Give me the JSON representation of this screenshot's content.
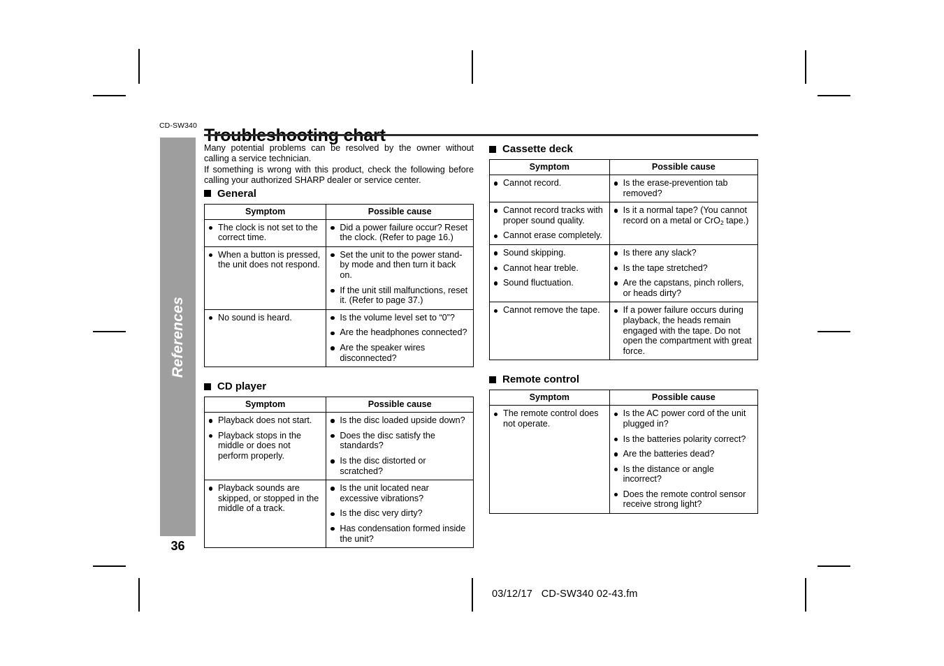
{
  "page": {
    "model_code": "CD-SW340",
    "title": "Troubleshooting chart",
    "side_tab_label": "References",
    "page_number": "36"
  },
  "intro": {
    "line1": "Many potential problems can be resolved by the owner without",
    "line2": "calling a service technician.",
    "line3": "If something is wrong with this product, check the following before",
    "line4": "calling your authorized SHARP dealer or service center."
  },
  "table_headers": {
    "symptom": "Symptom",
    "possible_cause": "Possible cause"
  },
  "sections": [
    {
      "id": "general",
      "heading": "General",
      "rows": [
        {
          "symptoms": [
            "The clock is not set to the correct time."
          ],
          "causes": [
            "Did a power failure occur? Reset the clock. (Refer to page 16.)"
          ]
        },
        {
          "symptoms": [
            "When a button is pressed, the unit does not respond."
          ],
          "causes": [
            "Set the unit to the power stand-by mode and then turn it back on.",
            "If the unit still malfunctions, reset it. (Refer to page 37.)"
          ]
        },
        {
          "symptoms": [
            "No sound is heard."
          ],
          "causes": [
            "Is the volume level set to “0”?",
            "Are the headphones connected?",
            "Are the speaker wires disconnected?"
          ]
        }
      ]
    },
    {
      "id": "cd-player",
      "heading": "CD player",
      "rows": [
        {
          "symptoms": [
            "Playback does not start.",
            "Playback stops in the middle or does not perform properly."
          ],
          "causes": [
            "Is the disc loaded upside down?",
            "Does the disc satisfy the standards?",
            "Is the disc distorted or scratched?"
          ]
        },
        {
          "symptoms": [
            "Playback sounds are skipped, or stopped in the middle of a track."
          ],
          "causes": [
            "Is the unit located near excessive vibrations?",
            "Is the disc very dirty?",
            "Has condensation formed inside the unit?"
          ]
        }
      ]
    },
    {
      "id": "cassette-deck",
      "heading": "Cassette deck",
      "rows": [
        {
          "symptoms": [
            "Cannot record."
          ],
          "causes": [
            "Is the erase-prevention tab removed?"
          ]
        },
        {
          "symptoms": [
            "Cannot record tracks with proper sound quality.",
            "Cannot erase completely."
          ],
          "causes_html": [
            "Is it a normal tape? (You cannot record on a metal or CrO<sub>2</sub> tape.)"
          ]
        },
        {
          "symptoms": [
            "Sound skipping.",
            "Cannot hear treble.",
            "Sound fluctuation."
          ],
          "causes": [
            "Is there any slack?",
            "Is the tape stretched?",
            "Are the capstans, pinch rollers, or heads dirty?"
          ]
        },
        {
          "symptoms": [
            "Cannot remove the tape."
          ],
          "causes": [
            "If a power failure occurs during playback, the heads remain engaged with the tape. Do not open the compartment with great force."
          ]
        }
      ]
    },
    {
      "id": "remote-control",
      "heading": "Remote control",
      "rows": [
        {
          "symptoms": [
            "The remote control does not operate."
          ],
          "causes": [
            "Is the AC power cord of the unit plugged in?",
            "Is the batteries polarity correct?",
            "Are the batteries dead?",
            "Is the distance or angle incorrect?",
            "Does the remote control sensor receive strong light?"
          ]
        }
      ]
    }
  ],
  "footer": {
    "date": "03/12/17",
    "filename": "CD-SW340 02-43.fm"
  },
  "colors": {
    "side_tab_gray": "#9e9e9e",
    "rule_black": "#2b2b2b"
  }
}
